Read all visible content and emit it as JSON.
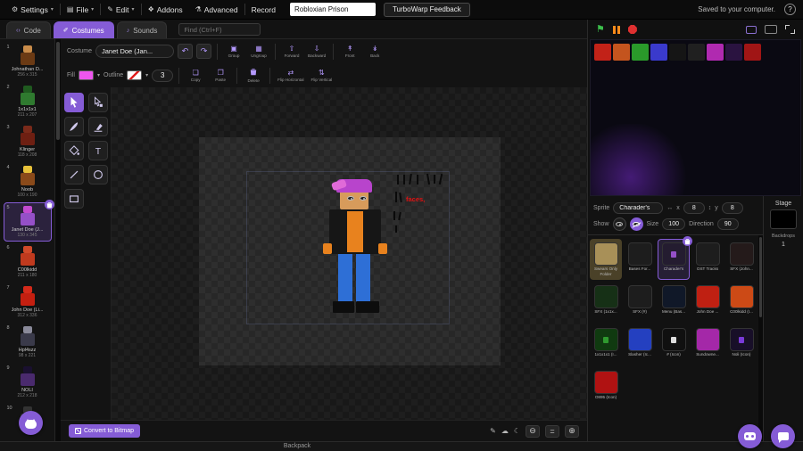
{
  "colors": {
    "accent": "#855cd6"
  },
  "glyphs": {
    "gear": "⚙",
    "file": "▤",
    "edit_pencil": "✎",
    "addons": "❖",
    "advanced": "⚗",
    "record_dot": "●",
    "caret": "▾",
    "code_tab": "‹›",
    "costumes_tab": "✐",
    "sounds_tab": "♪",
    "undo": "↶",
    "redo": "↷",
    "group": "▣",
    "ungroup": "▦",
    "forward": "⇧",
    "backward": "⇩",
    "front": "↟",
    "back": "↡",
    "copy": "❏",
    "paste": "❐",
    "flip_h": "⇄",
    "flip_v": "⇅",
    "flag": "⚑",
    "pen": "✎",
    "ghost": "☁",
    "moon": "☾",
    "zoom_out": "⊖",
    "zoom_in": "⊕",
    "x_arrows": "↔",
    "y_arrows": "↕"
  },
  "menu_bar": {
    "settings_label": "Settings",
    "file_label": "File",
    "edit_label": "Edit",
    "addons_label": "Addons",
    "advanced_label": "Advanced",
    "record_label": "Record",
    "project_title": "Robloxian Prison",
    "feedback_label": "TurboWarp Feedback",
    "saved_status": "Saved to your computer.",
    "help_label": "?"
  },
  "tabs": {
    "code": "Code",
    "costumes": "Costumes",
    "sounds": "Sounds",
    "find_placeholder": "Find (Ctrl+F)"
  },
  "paint": {
    "costume_label": "Costume",
    "costume_name_value": "Janet Doe (Jan...",
    "group_label": "Group",
    "ungroup_label": "Ungroup",
    "forward_label": "Forward",
    "backward_label": "Backward",
    "front_label": "Front",
    "back_label": "Back",
    "fill_label": "Fill",
    "outline_label": "Outline",
    "stroke_width_value": "3",
    "copy_label": "Copy",
    "paste_label": "Paste",
    "delete_label": "Delete",
    "flip_h_label": "Flip Horizontal",
    "flip_v_label": "Flip Vertical",
    "convert_button_label": "Convert to Bitmap",
    "zoom_equals_label": "=",
    "fill_color": "#ee56ee",
    "canvas_text": "faces,",
    "canvas_text_color": "#e01212",
    "tool_names": [
      "Select",
      "Reshape",
      "Brush",
      "Eraser",
      "Fill",
      "Text",
      "Line",
      "Circle",
      "Rectangle"
    ]
  },
  "character_colors": {
    "hair": "#b844cc",
    "hair_light": "#e06ad8",
    "skin": "#d79b5b",
    "jacket": "#161616",
    "shirt": "#e8821e",
    "hands": "#e8821e",
    "pants": "#2e6fd6",
    "shoes": "#0d0d0d"
  },
  "costumes": [
    {
      "num": "1",
      "name": "Johnathan D...",
      "size": "256 x 315",
      "head": "#c98c4a",
      "body": "#6b3a14"
    },
    {
      "num": "2",
      "name": "1x1x1x1",
      "size": "211 x 207",
      "head": "#1f5a1f",
      "body": "#2f7a2f"
    },
    {
      "num": "3",
      "name": "Klinger",
      "size": "118 x 208",
      "head": "#7a2a1a",
      "body": "#6e1f12"
    },
    {
      "num": "4",
      "name": "Noob",
      "size": "100 x 190",
      "head": "#e8c23a",
      "body": "#8a4a1a"
    },
    {
      "num": "5",
      "name": "Janet Doe (J...",
      "size": "130 x 345",
      "head": "#c24ad0",
      "body": "#9550c8",
      "selected": true
    },
    {
      "num": "6",
      "name": "C00lkidd",
      "size": "211 x 180",
      "head": "#d04a2a",
      "body": "#c03a1e"
    },
    {
      "num": "7",
      "name": "John Doe (Li...",
      "size": "312 x 336",
      "head": "#d42a1a",
      "body": "#c41f10"
    },
    {
      "num": "8",
      "name": "Hpl4szz",
      "size": "98 x 221",
      "head": "#8a8a9a",
      "body": "#3a3a4a"
    },
    {
      "num": "9",
      "name": "NOLI",
      "size": "212 x 218",
      "head": "#1a1030",
      "body": "#4a2a6e"
    },
    {
      "num": "10",
      "name": "",
      "size": "",
      "head": "#333333",
      "body": "#2a2a2a"
    }
  ],
  "sprite_panel": {
    "sprite_label": "Sprite",
    "sprite_name_value": "Charader's",
    "x_label": "x",
    "x_value": "8",
    "y_label": "y",
    "y_value": "8",
    "show_label": "Show",
    "size_label": "Size",
    "size_value": "100",
    "direction_label": "Direction",
    "direction_value": "90"
  },
  "sprites": [
    {
      "name": "Swears Only Folder",
      "color": "#a89058",
      "folder": true
    },
    {
      "name": "Bases For...",
      "color": "#1d1d1d"
    },
    {
      "name": "Charader's",
      "color": "#241c30",
      "dot": "#9550c8",
      "selected": true
    },
    {
      "name": "OST Tracks",
      "color": "#1d1d1d"
    },
    {
      "name": "SFX (John...",
      "color": "#241a1a"
    },
    {
      "name": "SFX (1x1x...",
      "color": "#163016"
    },
    {
      "name": "SFX (#)",
      "color": "#1d1d1d"
    },
    {
      "name": "Menu (Bas...",
      "color": "#101828"
    },
    {
      "name": "John Doe ...",
      "color": "#bf2012"
    },
    {
      "name": "C00lkidd (I...",
      "color": "#cc4a16"
    },
    {
      "name": "1x1x1x1 (I...",
      "color": "#103a10",
      "dot": "#2f9a2f"
    },
    {
      "name": "Slasher (Ic...",
      "color": "#2440c0"
    },
    {
      "name": "# (Icon)",
      "color": "#101010",
      "dot": "#dddddd"
    },
    {
      "name": "Sundowne...",
      "color": "#a428a8"
    },
    {
      "name": "Noli (Icon)",
      "color": "#180f28",
      "dot": "#7a3ad8"
    },
    {
      "name": "O895 (Icon)",
      "color": "#b01212"
    }
  ],
  "stage_preview": {
    "icons": [
      "#c22218",
      "#c4541e",
      "#2a9a2a",
      "#3a3acc",
      "#151515",
      "#202020",
      "#b02ab0",
      "#2a1340",
      "#a01515"
    ]
  },
  "stage_panel": {
    "title": "Stage",
    "backdrops_label": "Backdrops",
    "backdrops_count": "1"
  },
  "backpack_label": "Backpack"
}
